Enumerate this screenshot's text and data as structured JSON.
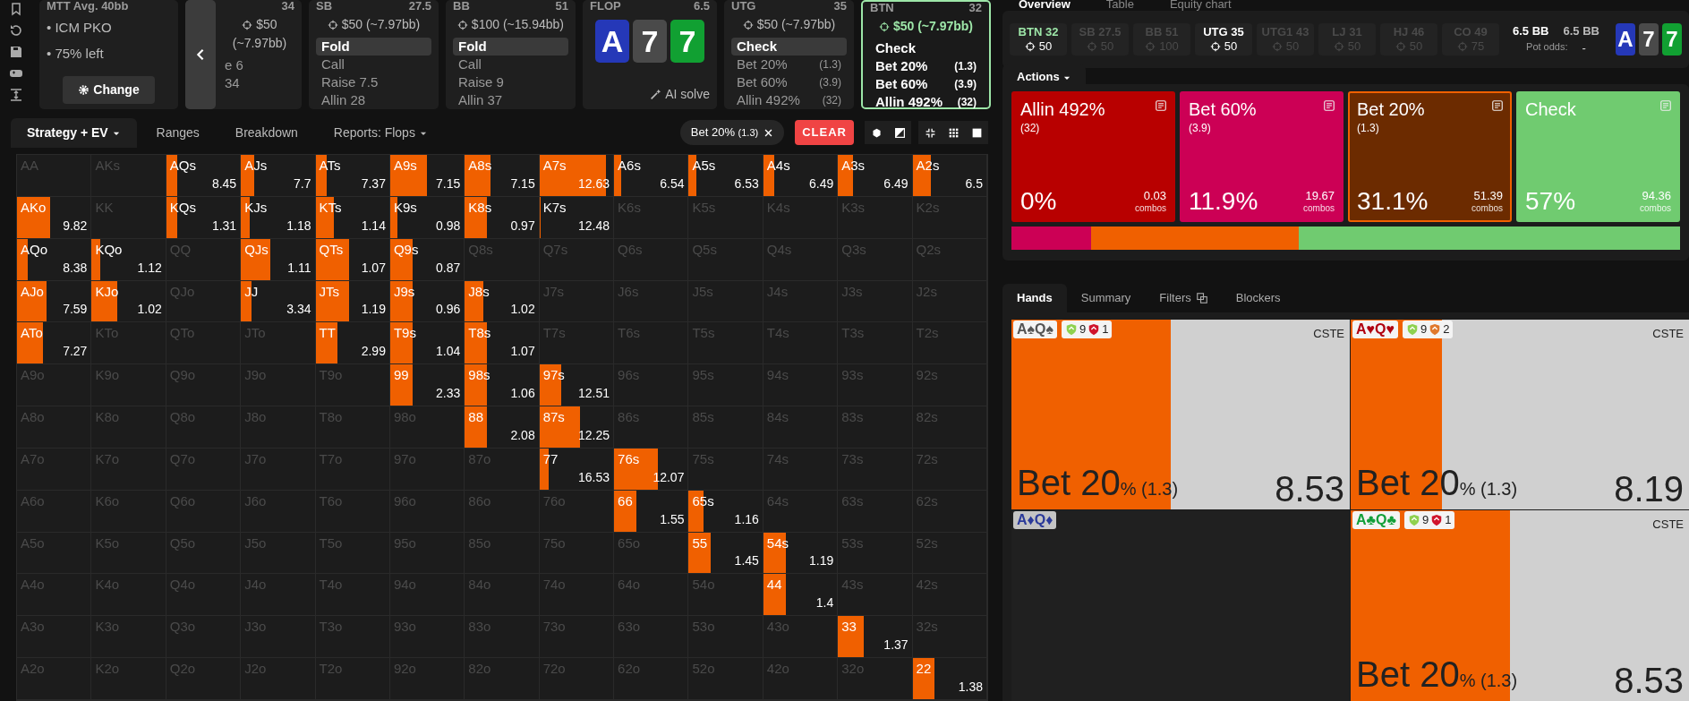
{
  "info": {
    "title": "MTT Avg. 40bb",
    "items": [
      "• ICM PKO",
      "• 75% left"
    ],
    "button": "Change"
  },
  "spots": [
    {
      "kind": "player",
      "stack": "34",
      "bet": "$50 (~7.97bb)",
      "selected": false,
      "actions": [
        {
          "label": "e 6",
          "selected": false
        },
        {
          "label": "34",
          "selected": false
        }
      ]
    },
    {
      "kind": "player",
      "pos": "SB",
      "stack": "27.5",
      "bet": "$50 (~7.97bb)",
      "selected": false,
      "actions": [
        {
          "label": "Fold",
          "selected": true
        },
        {
          "label": "Call",
          "selected": false
        },
        {
          "label": "Raise 7.5",
          "selected": false
        },
        {
          "label": "Allin 28",
          "selected": false
        }
      ]
    },
    {
      "kind": "player",
      "pos": "BB",
      "stack": "51",
      "bet": "$100 (~15.94bb)",
      "selected": false,
      "actions": [
        {
          "label": "Fold",
          "selected": true
        },
        {
          "label": "Call",
          "selected": false
        },
        {
          "label": "Raise 9",
          "selected": false
        },
        {
          "label": "Allin 37",
          "selected": false
        }
      ]
    },
    {
      "kind": "board",
      "pos": "FLOP",
      "selected": false,
      "stack": "6.5",
      "cards": [
        {
          "rank": "A",
          "color": "#2538b8"
        },
        {
          "rank": "7",
          "color": "#4a4a4a"
        },
        {
          "rank": "7",
          "color": "#11a032"
        }
      ],
      "button": "AI solve"
    },
    {
      "kind": "player",
      "pos": "UTG",
      "stack": "35",
      "bet": "$50 (~7.97bb)",
      "selected": false,
      "actions": [
        {
          "label": "Check",
          "selected": true
        },
        {
          "label": "Bet 20%",
          "size": "(1.3)",
          "selected": false
        },
        {
          "label": "Bet 60%",
          "size": "(3.9)",
          "selected": false
        },
        {
          "label": "Allin 492%",
          "size": "(32)",
          "selected": false
        }
      ]
    },
    {
      "kind": "player",
      "pos": "BTN",
      "stack": "32",
      "bet": "$50 (~7.97bb)",
      "selected": true,
      "actions": [
        {
          "label": "Check",
          "selected": false
        },
        {
          "label": "Bet 20%",
          "size": "(1.3)",
          "selected": false
        },
        {
          "label": "Bet 60%",
          "size": "(3.9)",
          "selected": false
        },
        {
          "label": "Allin 492%",
          "size": "(32)",
          "selected": false
        }
      ]
    }
  ],
  "toolbar": {
    "tabs": [
      {
        "label": "Strategy + EV",
        "dropdown": true,
        "selected": true
      },
      {
        "label": "Ranges",
        "dropdown": false,
        "selected": false
      },
      {
        "label": "Breakdown",
        "dropdown": false,
        "selected": false
      },
      {
        "label": "Reports: Flops",
        "dropdown": true,
        "selected": false
      }
    ],
    "filter_chip": {
      "label": "Bet 20%",
      "size": "(1.3)"
    },
    "clear_button": "CLEAR"
  },
  "grid": [
    [
      {
        "hand": "AA",
        "in_range": false
      },
      {
        "hand": "AKs",
        "in_range": false
      },
      {
        "hand": "AQs",
        "in_range": true,
        "value": "8.45",
        "level": 0.15
      },
      {
        "hand": "AJs",
        "in_range": true,
        "value": "7.7",
        "level": 0.18
      },
      {
        "hand": "ATs",
        "in_range": true,
        "value": "7.37",
        "level": 0.15
      },
      {
        "hand": "A9s",
        "in_range": true,
        "value": "7.15",
        "level": 0.5
      },
      {
        "hand": "A8s",
        "in_range": true,
        "value": "7.15",
        "level": 0.35
      },
      {
        "hand": "A7s",
        "in_range": true,
        "value": "12.63",
        "level": 0.9
      },
      {
        "hand": "A6s",
        "in_range": true,
        "value": "6.54",
        "level": 0.1
      },
      {
        "hand": "A5s",
        "in_range": true,
        "value": "6.53",
        "level": 0.1
      },
      {
        "hand": "A4s",
        "in_range": true,
        "value": "6.49",
        "level": 0.15
      },
      {
        "hand": "A3s",
        "in_range": true,
        "value": "6.49",
        "level": 0.2
      },
      {
        "hand": "A2s",
        "in_range": true,
        "value": "6.5",
        "level": 0.25
      }
    ],
    [
      {
        "hand": "AKo",
        "in_range": true,
        "value": "9.82",
        "level": 0.45
      },
      {
        "hand": "KK",
        "in_range": false
      },
      {
        "hand": "KQs",
        "in_range": true,
        "value": "1.31",
        "level": 0.15
      },
      {
        "hand": "KJs",
        "in_range": true,
        "value": "1.18",
        "level": 0.12
      },
      {
        "hand": "KTs",
        "in_range": true,
        "value": "1.14",
        "level": 0.25
      },
      {
        "hand": "K9s",
        "in_range": true,
        "value": "0.98",
        "level": 0.1
      },
      {
        "hand": "K8s",
        "in_range": true,
        "value": "0.97",
        "level": 0.3
      },
      {
        "hand": "K7s",
        "in_range": true,
        "value": "12.48",
        "level": 0.02
      },
      {
        "hand": "K6s",
        "in_range": false
      },
      {
        "hand": "K5s",
        "in_range": false
      },
      {
        "hand": "K4s",
        "in_range": false
      },
      {
        "hand": "K3s",
        "in_range": false
      },
      {
        "hand": "K2s",
        "in_range": false
      }
    ],
    [
      {
        "hand": "AQo",
        "in_range": true,
        "value": "8.38",
        "level": 0.15
      },
      {
        "hand": "KQo",
        "in_range": true,
        "value": "1.12",
        "level": 0.12
      },
      {
        "hand": "QQ",
        "in_range": false
      },
      {
        "hand": "QJs",
        "in_range": true,
        "value": "1.11",
        "level": 0.4
      },
      {
        "hand": "QTs",
        "in_range": true,
        "value": "1.07",
        "level": 0.45
      },
      {
        "hand": "Q9s",
        "in_range": true,
        "value": "0.87",
        "level": 0.3
      },
      {
        "hand": "Q8s",
        "in_range": false
      },
      {
        "hand": "Q7s",
        "in_range": false
      },
      {
        "hand": "Q6s",
        "in_range": false
      },
      {
        "hand": "Q5s",
        "in_range": false
      },
      {
        "hand": "Q4s",
        "in_range": false
      },
      {
        "hand": "Q3s",
        "in_range": false
      },
      {
        "hand": "Q2s",
        "in_range": false
      }
    ],
    [
      {
        "hand": "AJo",
        "in_range": true,
        "value": "7.59",
        "level": 0.4
      },
      {
        "hand": "KJo",
        "in_range": true,
        "value": "1.02",
        "level": 0.35
      },
      {
        "hand": "QJo",
        "in_range": false
      },
      {
        "hand": "JJ",
        "in_range": true,
        "value": "3.34",
        "level": 0.15
      },
      {
        "hand": "JTs",
        "in_range": true,
        "value": "1.19",
        "level": 0.45
      },
      {
        "hand": "J9s",
        "in_range": true,
        "value": "0.96",
        "level": 0.3
      },
      {
        "hand": "J8s",
        "in_range": true,
        "value": "1.02",
        "level": 0.25
      },
      {
        "hand": "J7s",
        "in_range": false
      },
      {
        "hand": "J6s",
        "in_range": false
      },
      {
        "hand": "J5s",
        "in_range": false
      },
      {
        "hand": "J4s",
        "in_range": false
      },
      {
        "hand": "J3s",
        "in_range": false
      },
      {
        "hand": "J2s",
        "in_range": false
      }
    ],
    [
      {
        "hand": "ATo",
        "in_range": true,
        "value": "7.27",
        "level": 0.35
      },
      {
        "hand": "KTo",
        "in_range": false
      },
      {
        "hand": "QTo",
        "in_range": false
      },
      {
        "hand": "JTo",
        "in_range": false
      },
      {
        "hand": "TT",
        "in_range": true,
        "value": "2.99",
        "level": 0.3
      },
      {
        "hand": "T9s",
        "in_range": true,
        "value": "1.04",
        "level": 0.3
      },
      {
        "hand": "T8s",
        "in_range": true,
        "value": "1.07",
        "level": 0.3
      },
      {
        "hand": "T7s",
        "in_range": false
      },
      {
        "hand": "T6s",
        "in_range": false
      },
      {
        "hand": "T5s",
        "in_range": false
      },
      {
        "hand": "T4s",
        "in_range": false
      },
      {
        "hand": "T3s",
        "in_range": false
      },
      {
        "hand": "T2s",
        "in_range": false
      }
    ],
    [
      {
        "hand": "A9o",
        "in_range": false
      },
      {
        "hand": "K9o",
        "in_range": false
      },
      {
        "hand": "Q9o",
        "in_range": false
      },
      {
        "hand": "J9o",
        "in_range": false
      },
      {
        "hand": "T9o",
        "in_range": false
      },
      {
        "hand": "99",
        "in_range": true,
        "value": "2.33",
        "level": 0.3
      },
      {
        "hand": "98s",
        "in_range": true,
        "value": "1.06",
        "level": 0.3
      },
      {
        "hand": "97s",
        "in_range": true,
        "value": "12.51",
        "level": 0.3
      },
      {
        "hand": "96s",
        "in_range": false
      },
      {
        "hand": "95s",
        "in_range": false
      },
      {
        "hand": "94s",
        "in_range": false
      },
      {
        "hand": "93s",
        "in_range": false
      },
      {
        "hand": "92s",
        "in_range": false
      }
    ],
    [
      {
        "hand": "A8o",
        "in_range": false
      },
      {
        "hand": "K8o",
        "in_range": false
      },
      {
        "hand": "Q8o",
        "in_range": false
      },
      {
        "hand": "J8o",
        "in_range": false
      },
      {
        "hand": "T8o",
        "in_range": false
      },
      {
        "hand": "98o",
        "in_range": false
      },
      {
        "hand": "88",
        "in_range": true,
        "value": "2.08",
        "level": 0.3
      },
      {
        "hand": "87s",
        "in_range": true,
        "value": "12.25",
        "level": 0.55
      },
      {
        "hand": "86s",
        "in_range": false
      },
      {
        "hand": "85s",
        "in_range": false
      },
      {
        "hand": "84s",
        "in_range": false
      },
      {
        "hand": "83s",
        "in_range": false
      },
      {
        "hand": "82s",
        "in_range": false
      }
    ],
    [
      {
        "hand": "A7o",
        "in_range": false
      },
      {
        "hand": "K7o",
        "in_range": false
      },
      {
        "hand": "Q7o",
        "in_range": false
      },
      {
        "hand": "J7o",
        "in_range": false
      },
      {
        "hand": "T7o",
        "in_range": false
      },
      {
        "hand": "97o",
        "in_range": false
      },
      {
        "hand": "87o",
        "in_range": false
      },
      {
        "hand": "77",
        "in_range": true,
        "value": "16.53",
        "level": 0.12
      },
      {
        "hand": "76s",
        "in_range": true,
        "value": "12.07",
        "level": 0.6
      },
      {
        "hand": "75s",
        "in_range": false
      },
      {
        "hand": "74s",
        "in_range": false
      },
      {
        "hand": "73s",
        "in_range": false
      },
      {
        "hand": "72s",
        "in_range": false
      }
    ],
    [
      {
        "hand": "A6o",
        "in_range": false
      },
      {
        "hand": "K6o",
        "in_range": false
      },
      {
        "hand": "Q6o",
        "in_range": false
      },
      {
        "hand": "J6o",
        "in_range": false
      },
      {
        "hand": "T6o",
        "in_range": false
      },
      {
        "hand": "96o",
        "in_range": false
      },
      {
        "hand": "86o",
        "in_range": false
      },
      {
        "hand": "76o",
        "in_range": false
      },
      {
        "hand": "66",
        "in_range": true,
        "value": "1.55",
        "level": 0.3
      },
      {
        "hand": "65s",
        "in_range": true,
        "value": "1.16",
        "level": 0.2
      },
      {
        "hand": "64s",
        "in_range": false
      },
      {
        "hand": "63s",
        "in_range": false
      },
      {
        "hand": "62s",
        "in_range": false
      }
    ],
    [
      {
        "hand": "A5o",
        "in_range": false
      },
      {
        "hand": "K5o",
        "in_range": false
      },
      {
        "hand": "Q5o",
        "in_range": false
      },
      {
        "hand": "J5o",
        "in_range": false
      },
      {
        "hand": "T5o",
        "in_range": false
      },
      {
        "hand": "95o",
        "in_range": false
      },
      {
        "hand": "85o",
        "in_range": false
      },
      {
        "hand": "75o",
        "in_range": false
      },
      {
        "hand": "65o",
        "in_range": false
      },
      {
        "hand": "55",
        "in_range": true,
        "value": "1.45",
        "level": 0.3
      },
      {
        "hand": "54s",
        "in_range": true,
        "value": "1.19",
        "level": 0.3
      },
      {
        "hand": "53s",
        "in_range": false
      },
      {
        "hand": "52s",
        "in_range": false
      }
    ],
    [
      {
        "hand": "A4o",
        "in_range": false
      },
      {
        "hand": "K4o",
        "in_range": false
      },
      {
        "hand": "Q4o",
        "in_range": false
      },
      {
        "hand": "J4o",
        "in_range": false
      },
      {
        "hand": "T4o",
        "in_range": false
      },
      {
        "hand": "94o",
        "in_range": false
      },
      {
        "hand": "84o",
        "in_range": false
      },
      {
        "hand": "74o",
        "in_range": false
      },
      {
        "hand": "64o",
        "in_range": false
      },
      {
        "hand": "54o",
        "in_range": false
      },
      {
        "hand": "44",
        "in_range": true,
        "value": "1.4",
        "level": 0.3
      },
      {
        "hand": "43s",
        "in_range": false
      },
      {
        "hand": "42s",
        "in_range": false
      }
    ],
    [
      {
        "hand": "A3o",
        "in_range": false
      },
      {
        "hand": "K3o",
        "in_range": false
      },
      {
        "hand": "Q3o",
        "in_range": false
      },
      {
        "hand": "J3o",
        "in_range": false
      },
      {
        "hand": "T3o",
        "in_range": false
      },
      {
        "hand": "93o",
        "in_range": false
      },
      {
        "hand": "83o",
        "in_range": false
      },
      {
        "hand": "73o",
        "in_range": false
      },
      {
        "hand": "63o",
        "in_range": false
      },
      {
        "hand": "53o",
        "in_range": false
      },
      {
        "hand": "43o",
        "in_range": false
      },
      {
        "hand": "33",
        "in_range": true,
        "value": "1.37",
        "level": 0.35
      },
      {
        "hand": "32s",
        "in_range": false
      }
    ],
    [
      {
        "hand": "A2o",
        "in_range": false
      },
      {
        "hand": "K2o",
        "in_range": false
      },
      {
        "hand": "Q2o",
        "in_range": false
      },
      {
        "hand": "J2o",
        "in_range": false
      },
      {
        "hand": "T2o",
        "in_range": false
      },
      {
        "hand": "92o",
        "in_range": false
      },
      {
        "hand": "82o",
        "in_range": false
      },
      {
        "hand": "72o",
        "in_range": false
      },
      {
        "hand": "62o",
        "in_range": false
      },
      {
        "hand": "52o",
        "in_range": false
      },
      {
        "hand": "42o",
        "in_range": false
      },
      {
        "hand": "32o",
        "in_range": false
      },
      {
        "hand": "22",
        "in_range": true,
        "value": "1.38",
        "level": 0.3
      }
    ]
  ],
  "overview_tabs": [
    {
      "label": "Overview",
      "selected": true
    },
    {
      "label": "Table",
      "selected": false
    },
    {
      "label": "Equity chart",
      "selected": false
    }
  ],
  "positions": [
    {
      "pos": "BTN",
      "stack": "32",
      "chips": "50",
      "selected": true,
      "folded": false
    },
    {
      "pos": "SB",
      "stack": "27.5",
      "chips": "50",
      "selected": false,
      "folded": true
    },
    {
      "pos": "BB",
      "stack": "51",
      "chips": "100",
      "selected": false,
      "folded": true
    },
    {
      "pos": "UTG",
      "stack": "35",
      "chips": "50",
      "selected": false,
      "folded": false
    },
    {
      "pos": "UTG1",
      "stack": "43",
      "chips": "50",
      "selected": false,
      "folded": true
    },
    {
      "pos": "LJ",
      "stack": "31",
      "chips": "50",
      "selected": false,
      "folded": true
    },
    {
      "pos": "HJ",
      "stack": "46",
      "chips": "50",
      "selected": false,
      "folded": true
    },
    {
      "pos": "CO",
      "stack": "49",
      "chips": "75",
      "selected": false,
      "folded": true
    }
  ],
  "pot": {
    "pot": "6.5 BB",
    "effective": "6.5 BB",
    "odds_label": "Pot odds:",
    "odds": "-"
  },
  "board": [
    {
      "rank": "A",
      "color": "#2538b8"
    },
    {
      "rank": "7",
      "color": "#4a4a4a"
    },
    {
      "rank": "7",
      "color": "#11a032"
    }
  ],
  "actions_menu": "Actions",
  "actions": [
    {
      "label": "Allin 492%",
      "size": "(32)",
      "percent": "0%",
      "combos": "0.03",
      "combos_label": "combos",
      "color": "#b80000",
      "selected": false
    },
    {
      "label": "Bet 60%",
      "size": "(3.9)",
      "percent": "11.9%",
      "combos": "19.67",
      "combos_label": "combos",
      "color": "#cc0055",
      "selected": false
    },
    {
      "label": "Bet 20%",
      "size": "(1.3)",
      "percent": "31.1%",
      "combos": "51.39",
      "combos_label": "combos",
      "color": "#f06000",
      "selected": true
    },
    {
      "label": "Check",
      "percent": "57%",
      "combos": "94.36",
      "combos_label": "combos",
      "color": "#70cb70",
      "selected": false
    }
  ],
  "distribution": [
    {
      "level": 0.119,
      "color": "#cc0055"
    },
    {
      "level": 0.311,
      "color": "#f06000"
    },
    {
      "level": 0.57,
      "color": "#70cb70"
    }
  ],
  "hands_tabs": [
    {
      "label": "Hands",
      "icon": false,
      "selected": true
    },
    {
      "label": "Summary",
      "icon": false,
      "selected": false
    },
    {
      "label": "Filters",
      "icon": true,
      "selected": false
    },
    {
      "label": "Blockers",
      "icon": false,
      "selected": false
    }
  ],
  "hands": [
    {
      "combo": "A♠Q♠",
      "color": "#555555",
      "available": true,
      "badges": [
        {
          "text": "9",
          "color": "#8fd14f"
        },
        {
          "text": "1",
          "color": "#d0142c"
        }
      ],
      "tag": "CSTE",
      "action": "Bet 20",
      "unit": "%",
      "size": "(1.3)",
      "level": 0.47,
      "value": "8.53"
    },
    {
      "combo": "A♥Q♥",
      "color": "#b00010",
      "available": true,
      "badges": [
        {
          "text": "9",
          "color": "#8fd14f"
        },
        {
          "text": "2",
          "color": "#e0782c"
        }
      ],
      "tag": "CSTE",
      "action": "Bet 20",
      "unit": "%",
      "size": "(1.3)",
      "level": 0.27,
      "value": "8.19"
    },
    {
      "combo": "A♦Q♦",
      "color": "#2b3a9a",
      "available": false
    },
    {
      "combo": "A♣Q♣",
      "color": "#13a03a",
      "available": true,
      "badges": [
        {
          "text": "9",
          "color": "#8fd14f"
        },
        {
          "text": "1",
          "color": "#d0142c"
        }
      ],
      "tag": "CSTE",
      "action": "Bet 20",
      "unit": "%",
      "size": "(1.3)",
      "level": 0.47,
      "value": "8.53"
    }
  ]
}
